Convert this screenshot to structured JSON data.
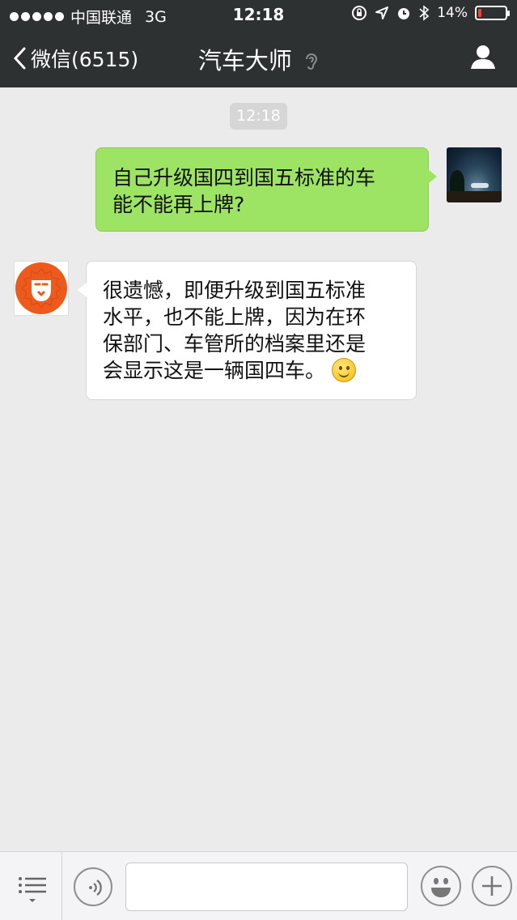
{
  "status_bar": {
    "carrier": "中国联通",
    "network": "3G",
    "time": "12:18",
    "battery": "14%",
    "battery_level": 0.14
  },
  "nav": {
    "back_label": "微信(6515)",
    "title": "汽车大师"
  },
  "chat": {
    "timestamp": "12:18",
    "messages": [
      {
        "from": "me",
        "lines": [
          "自己升级国四到国五标准的车",
          "能不能再上牌?"
        ]
      },
      {
        "from": "bot",
        "lines": [
          "很遗憾，即便升级到国五标准",
          "水平，也不能上牌，因为在环",
          "保部门、车管所的档案里还是",
          "会显示这是一辆国四车。"
        ],
        "emoji": "smile-emoji"
      }
    ]
  },
  "colors": {
    "nav_bg": "#2e3132",
    "chat_bg": "#ebebeb",
    "my_bubble": "#9ee464",
    "bot_bubble": "#ffffff",
    "bot_avatar": "#ec5a1e"
  },
  "toolbar": {
    "input_value": "",
    "icons": [
      "menu-icon",
      "voice-icon",
      "emoji-icon",
      "plus-icon"
    ]
  }
}
